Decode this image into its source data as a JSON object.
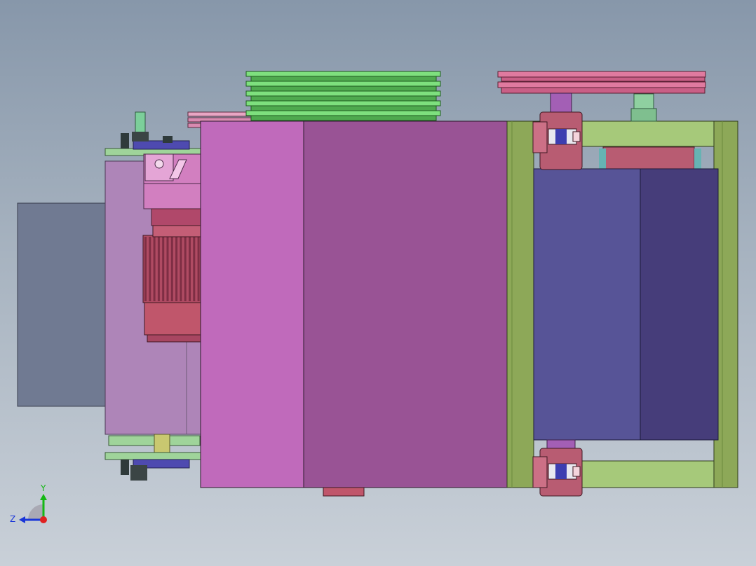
{
  "viewport": {
    "background_top": "#8797aa",
    "background_bottom": "#c9d0d8"
  },
  "model": {
    "components": [
      "motor-housing",
      "gear-reducer",
      "drive-motor",
      "main-enclosure",
      "multi-groove-pulley",
      "double-groove-pulley",
      "green-frame",
      "bearing-block-top",
      "bearing-block-bottom",
      "blue-cover"
    ],
    "colors": {
      "enclosure_light": "#c06abb",
      "enclosure_dark": "#995395",
      "frame_green": "#8da858",
      "pulley_green": "#6fcf6f",
      "pulley_pink": "#d86b8e",
      "bearing_red": "#b85c72",
      "cover_blue": "#575497",
      "cover_blue_dark": "#463d7a",
      "motor_red": "#c0566b",
      "side_block": "#707a92"
    }
  },
  "triad": {
    "y_label": "Y",
    "z_label": "Z",
    "y_color": "#14b814",
    "z_color": "#1a36d8",
    "x_color": "#e02020"
  }
}
